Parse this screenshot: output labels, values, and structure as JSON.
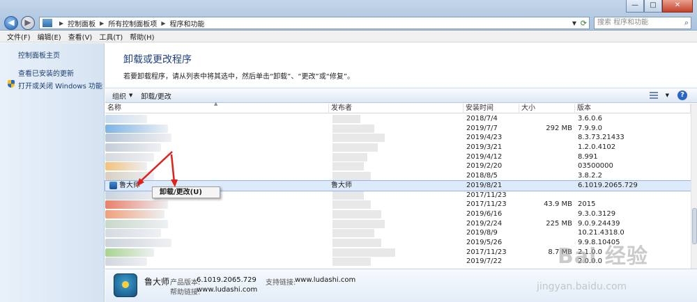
{
  "window": {
    "minimize": "—",
    "maximize": "□",
    "close": "✕"
  },
  "address": {
    "crumbs": [
      "控制面板",
      "所有控制面板项",
      "程序和功能"
    ],
    "search_placeholder": "搜索 程序和功能"
  },
  "menu": [
    "文件(F)",
    "编辑(E)",
    "查看(V)",
    "工具(T)",
    "帮助(H)"
  ],
  "sidebar": {
    "home": "控制面板主页",
    "updates": "查看已安装的更新",
    "features": "打开或关闭 Windows 功能"
  },
  "main": {
    "heading": "卸载或更改程序",
    "description": "若要卸载程序，请从列表中将其选中，然后单击“卸载”、“更改”或“修复”。"
  },
  "toolbar": {
    "organize": "组织",
    "uninstall_change": "卸载/更改"
  },
  "columns": {
    "name": "名称",
    "publisher": "发布者",
    "installed_on": "安装时间",
    "size": "大小",
    "version": "版本"
  },
  "rows": [
    {
      "name": "",
      "publisher": "",
      "date": "2018/7/4",
      "size": "",
      "version": "3.6.0.6"
    },
    {
      "name": "",
      "publisher": "",
      "date": "2019/7/7",
      "size": "292 MB",
      "version": "7.9.9.0"
    },
    {
      "name": "",
      "publisher": "",
      "date": "2019/4/23",
      "size": "",
      "version": "8.3.73.21433"
    },
    {
      "name": "",
      "publisher": "",
      "date": "2019/3/21",
      "size": "",
      "version": "1.2.0.4102"
    },
    {
      "name": "",
      "publisher": "",
      "date": "2019/4/12",
      "size": "",
      "version": "8.991"
    },
    {
      "name": "",
      "publisher": "",
      "date": "2019/2/20",
      "size": "",
      "version": "03500000"
    },
    {
      "name": "",
      "publisher": "",
      "date": "2018/8/5",
      "size": "",
      "version": "3.8.2.2"
    },
    {
      "name": "鲁大师",
      "publisher": "鲁大师",
      "date": "2019/8/21",
      "size": "",
      "version": "6.1019.2065.729",
      "selected": true
    },
    {
      "name": "",
      "publisher": "",
      "date": "2017/11/23",
      "size": "",
      "version": ""
    },
    {
      "name": "",
      "publisher": "",
      "date": "2017/11/23",
      "size": "43.9 MB",
      "version": "2015"
    },
    {
      "name": "",
      "publisher": "",
      "date": "2019/6/16",
      "size": "",
      "version": "9.3.0.3129"
    },
    {
      "name": "",
      "publisher": "",
      "date": "2019/2/24",
      "size": "225 MB",
      "version": "9.0.9.24439"
    },
    {
      "name": "",
      "publisher": "",
      "date": "2019/8/9",
      "size": "",
      "version": "10.21.4318.0"
    },
    {
      "name": "",
      "publisher": "",
      "date": "2019/5/26",
      "size": "",
      "version": "9.9.8.10405"
    },
    {
      "name": "",
      "publisher": "",
      "date": "2017/11/23",
      "size": "8.7 MB",
      "version": "2.1.0.0"
    },
    {
      "name": "",
      "publisher": "",
      "date": "2019/7/22",
      "size": "",
      "version": "2.0.0.0"
    }
  ],
  "context_menu": {
    "item": "卸载/更改(U)"
  },
  "details": {
    "name": "鲁大师",
    "version_label": "产品版本:",
    "version_value": "6.1019.2065.729",
    "support_label": "支持链接:",
    "support_value": "www.ludashi.com",
    "help_label": "帮助链接:",
    "help_value": "www.ludashi.com"
  },
  "watermark": {
    "line1": "Bai 经验",
    "line2": "jingyan.baidu.com"
  },
  "colors": {
    "accent": "#1e3f8a",
    "annotation": "#e0201b",
    "selected_row": "#dceafb"
  }
}
